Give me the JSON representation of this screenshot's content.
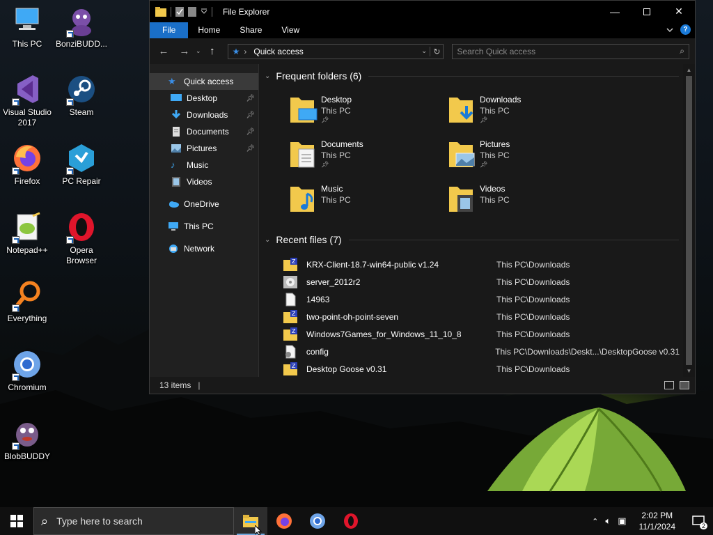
{
  "desktop": {
    "icons": [
      {
        "label": "This PC",
        "icon": "computer-icon"
      },
      {
        "label": "BonziBUDD...",
        "icon": "purple-gorilla-icon"
      },
      {
        "label": "Visual Studio 2017",
        "icon": "visual-studio-icon"
      },
      {
        "label": "Steam",
        "icon": "steam-icon"
      },
      {
        "label": "Firefox",
        "icon": "firefox-icon"
      },
      {
        "label": "PC Repair",
        "icon": "pc-repair-icon"
      },
      {
        "label": "Notepad++",
        "icon": "notepad-plus-plus-icon"
      },
      {
        "label": "Opera Browser",
        "icon": "opera-icon"
      },
      {
        "label": "Everything",
        "icon": "everything-search-icon"
      },
      {
        "label": "Chromium",
        "icon": "chromium-icon"
      },
      {
        "label": "BlobBUDDY",
        "icon": "blob-creature-icon"
      }
    ]
  },
  "explorer": {
    "title": "File Explorer",
    "ribbon_tabs": [
      "File",
      "Home",
      "Share",
      "View"
    ],
    "address": "Quick access",
    "search_placeholder": "Search Quick access",
    "nav_pane": {
      "quick_access": "Quick access",
      "pinned": [
        "Desktop",
        "Downloads",
        "Documents",
        "Pictures"
      ],
      "unpinned": [
        "Music",
        "Videos"
      ],
      "onedrive": "OneDrive",
      "this_pc": "This PC",
      "network": "Network"
    },
    "frequent_header": "Frequent folders (6)",
    "frequent_folders": [
      {
        "name": "Desktop",
        "location": "This PC",
        "pinned": true
      },
      {
        "name": "Downloads",
        "location": "This PC",
        "pinned": true
      },
      {
        "name": "Documents",
        "location": "This PC",
        "pinned": true
      },
      {
        "name": "Pictures",
        "location": "This PC",
        "pinned": true
      },
      {
        "name": "Music",
        "location": "This PC",
        "pinned": false
      },
      {
        "name": "Videos",
        "location": "This PC",
        "pinned": false
      }
    ],
    "recent_header": "Recent files (7)",
    "recent_files": [
      {
        "name": "KRX-Client-18.7-win64-public v1.24",
        "path": "This PC\\Downloads",
        "icon": "zip-folder-icon"
      },
      {
        "name": "server_2012r2",
        "path": "This PC\\Downloads",
        "icon": "disc-image-icon"
      },
      {
        "name": "14963",
        "path": "This PC\\Downloads",
        "icon": "file-icon"
      },
      {
        "name": "two-point-oh-point-seven",
        "path": "This PC\\Downloads",
        "icon": "zip-folder-icon"
      },
      {
        "name": "Windows7Games_for_Windows_11_10_8",
        "path": "This PC\\Downloads",
        "icon": "zip-folder-icon"
      },
      {
        "name": "config",
        "path": "This PC\\Downloads\\Deskt...\\DesktopGoose v0.31",
        "icon": "config-file-icon"
      },
      {
        "name": "Desktop Goose v0.31",
        "path": "This PC\\Downloads",
        "icon": "zip-folder-icon"
      }
    ],
    "status": "13 items"
  },
  "taskbar": {
    "search_placeholder": "Type here to search",
    "time": "2:02 PM",
    "date": "11/1/2024",
    "notification_count": "2"
  },
  "colors": {
    "accent": "#1a6fc8",
    "folder": "#f2c94c",
    "window_bg": "#191919"
  }
}
